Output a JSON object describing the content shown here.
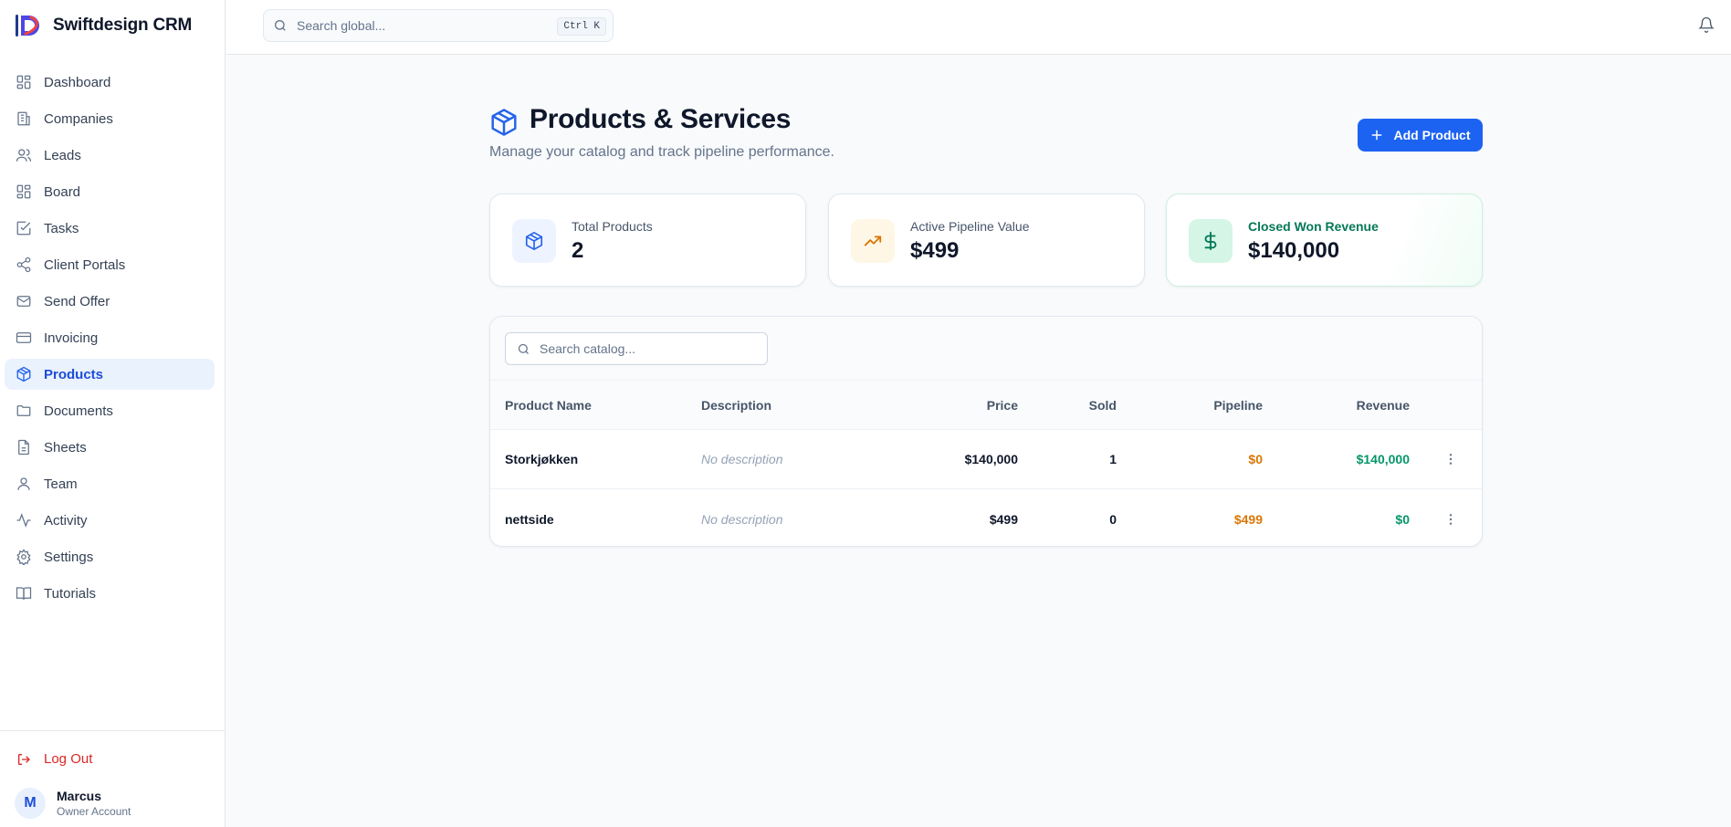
{
  "app": {
    "name": "Swiftdesign CRM"
  },
  "sidebar": {
    "items": [
      {
        "label": "Dashboard",
        "icon": "dashboard-icon"
      },
      {
        "label": "Companies",
        "icon": "building-icon"
      },
      {
        "label": "Leads",
        "icon": "users-icon"
      },
      {
        "label": "Board",
        "icon": "board-icon"
      },
      {
        "label": "Tasks",
        "icon": "check-square-icon"
      },
      {
        "label": "Client Portals",
        "icon": "share-icon"
      },
      {
        "label": "Send Offer",
        "icon": "mail-icon"
      },
      {
        "label": "Invoicing",
        "icon": "credit-card-icon"
      },
      {
        "label": "Products",
        "icon": "package-icon",
        "active": true
      },
      {
        "label": "Documents",
        "icon": "folder-icon"
      },
      {
        "label": "Sheets",
        "icon": "file-text-icon"
      },
      {
        "label": "Team",
        "icon": "user-icon"
      },
      {
        "label": "Activity",
        "icon": "activity-icon"
      },
      {
        "label": "Settings",
        "icon": "gear-icon"
      },
      {
        "label": "Tutorials",
        "icon": "book-icon"
      }
    ],
    "logout_label": "Log Out",
    "user": {
      "initial": "M",
      "name": "Marcus",
      "role": "Owner Account"
    }
  },
  "topbar": {
    "search_placeholder": "Search global...",
    "shortcut": "Ctrl K"
  },
  "page": {
    "title": "Products & Services",
    "subtitle": "Manage your catalog and track pipeline performance.",
    "add_button": "Add Product"
  },
  "stats": [
    {
      "label": "Total Products",
      "value": "2",
      "icon": "package-icon"
    },
    {
      "label": "Active Pipeline Value",
      "value": "$499",
      "icon": "trending-up-icon"
    },
    {
      "label": "Closed Won Revenue",
      "value": "$140,000",
      "icon": "dollar-icon"
    }
  ],
  "catalog": {
    "search_placeholder": "Search catalog...",
    "columns": {
      "name": "Product Name",
      "description": "Description",
      "price": "Price",
      "sold": "Sold",
      "pipeline": "Pipeline",
      "revenue": "Revenue"
    },
    "rows": [
      {
        "name": "Storkjøkken",
        "description": "No description",
        "price": "$140,000",
        "sold": "1",
        "pipeline": "$0",
        "revenue": "$140,000"
      },
      {
        "name": "nettside",
        "description": "No description",
        "price": "$499",
        "sold": "0",
        "pipeline": "$499",
        "revenue": "$0"
      }
    ]
  },
  "colors": {
    "accent": "#1d63f2",
    "pipeline": "#d97706",
    "revenue": "#059669",
    "danger": "#dc2626"
  }
}
